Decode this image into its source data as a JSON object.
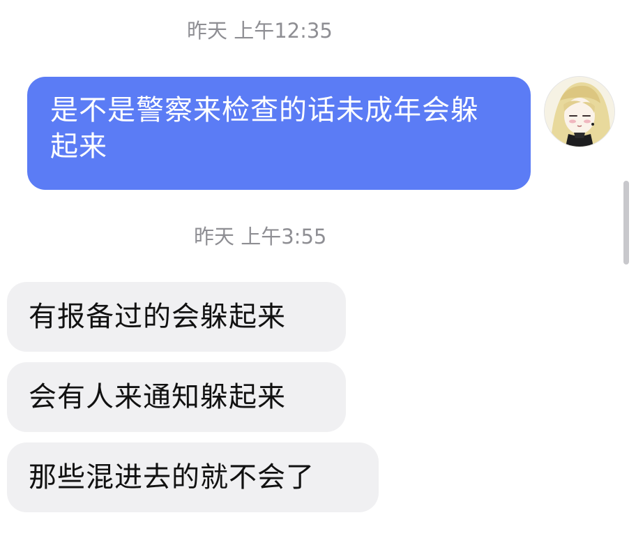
{
  "messages": [
    {
      "timestamp": "昨天 上午12:35",
      "direction": "outgoing",
      "text": "是不是警察来检查的话未成年会躲起来"
    },
    {
      "timestamp": "昨天 上午3:55",
      "direction": "incoming",
      "bubbles": [
        "有报备过的会躲起来",
        "会有人来通知躲起来",
        "那些混进去的就不会了"
      ]
    }
  ],
  "avatar": {
    "icon": "anime-girl-avatar"
  },
  "colors": {
    "outgoing_bubble": "#5b7cf5",
    "incoming_bubble": "#f0f0f2",
    "timestamp_text": "#8e8e93"
  }
}
